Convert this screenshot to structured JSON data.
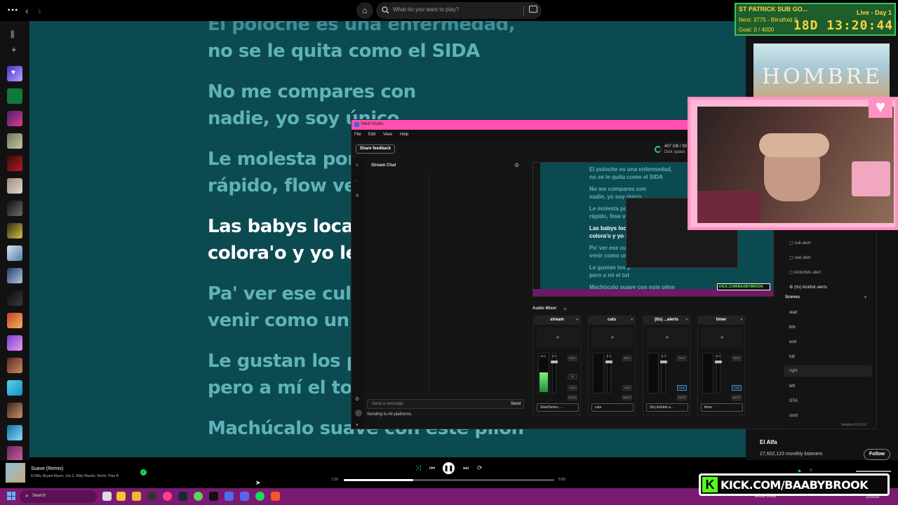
{
  "spotify": {
    "search_placeholder": "What do you want to play?",
    "lyrics": [
      "El poloche es una enfermedad,",
      "no se le quita como el SIDA",
      "No me compares con",
      "nadie, yo soy único",
      "Le molesta por",
      "rápido, flow ve",
      "Las babys loca",
      "colora'o y yo le",
      "Pa' ver ese culo",
      "venir como un r",
      "Le gustan los p",
      "pero a mí el tot",
      "Machúcalo suave con este pilón"
    ],
    "now_playing": {
      "title": "Suave (Remix)",
      "artists": "El Alfa, Bryant Myers, Jon Z, Miky Woodz, Noriel, Plan B",
      "elapsed": "1:39",
      "duration": "5:05",
      "progress": 0.33
    },
    "artist_panel": {
      "name": "El Alfa",
      "listeners": "27,602,123 monthly listeners",
      "follow_label": "Follow"
    },
    "artwork_title": "HOMBRE"
  },
  "overlay": {
    "title": "ST PATRICK SUB GO...",
    "next": "Next: 3775 - Blindfold S",
    "goal": "Goal: 0 / 4000",
    "live": "Live - Day 1",
    "timer": "18D 13:20:44",
    "kick_url": "KICK.COM/BAABYBROOK"
  },
  "meld": {
    "title": "Meld Studio",
    "menu": [
      "File",
      "Edit",
      "View",
      "Help"
    ],
    "share_feedback": "Share feedback",
    "disk_value": "407 GB / 93",
    "disk_label": "Disk space",
    "chat_title": "Stream Chat",
    "message_placeholder": "Send a message",
    "send_label": "Send",
    "sending_to": "Sending to All platforms.",
    "audio_mixer": "Audio Mixer",
    "preview_lyrics": [
      "El poloche es una enfermedad,",
      "no se le quita como el SIDA",
      "No me compares con",
      "nadie, yo soy único",
      "Le molesta por",
      "rápido, flow ve",
      "Las babys loca",
      "colora'o y yo le",
      "Pa' ver ese culo",
      "venir como un r",
      "Le gustan los p",
      "pero a mí el tot",
      "Machúcalo suave con este pilon"
    ],
    "preview_kick": "KICK.COM/BAABYBROOK",
    "tracks": [
      {
        "name": "stream",
        "level": "-16.2",
        "gain": "0.0",
        "source": "SteelSeries ..."
      },
      {
        "name": "cats",
        "level": "",
        "gain": "0.0",
        "source": "cats"
      },
      {
        "name": "(tts) ...alerts",
        "level": "",
        "gain": "0.0",
        "source": "(tts) kickbot a..."
      },
      {
        "name": "timer",
        "level": "",
        "gain": "0.0",
        "source": "timer"
      }
    ],
    "edit_label": "EDIT",
    "cue_label": "CUE",
    "mute_label": "MUTE",
    "layers": [
      "sub alert",
      "raid alert",
      "kicks/bits alert",
      "(tts) kickbot alerts"
    ],
    "scenes_title": "Scenes",
    "scenes": [
      "start",
      "brb",
      "end",
      "full",
      "right",
      "left",
      "GTA",
      "cord"
    ],
    "active_scene": "right",
    "version": "Version 0.9.10.0"
  },
  "taskbar": {
    "search_label": "Search",
    "weather": "Mostly cloudy",
    "date": "3/3/2026"
  }
}
